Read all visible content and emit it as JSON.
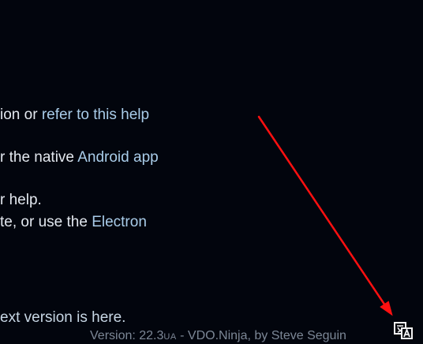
{
  "content": {
    "line1_text": "ion or ",
    "line1_link": "refer to this help",
    "line2_text": "r the native ",
    "line2_link": "Android app",
    "line3_text": "r help.",
    "line4_text": "te, or use the ",
    "line4_link": "Electron",
    "line5_text": "ext version is here."
  },
  "footer": {
    "version_prefix": "Version: 22.3",
    "version_suffix": "UA",
    "credit": " - VDO.Ninja, by Steve Seguin"
  },
  "colors": {
    "background": "#02050d",
    "link": "#a9cce9",
    "annotation_arrow": "#ff1010"
  },
  "icons": {
    "translate": "translate-icon"
  }
}
